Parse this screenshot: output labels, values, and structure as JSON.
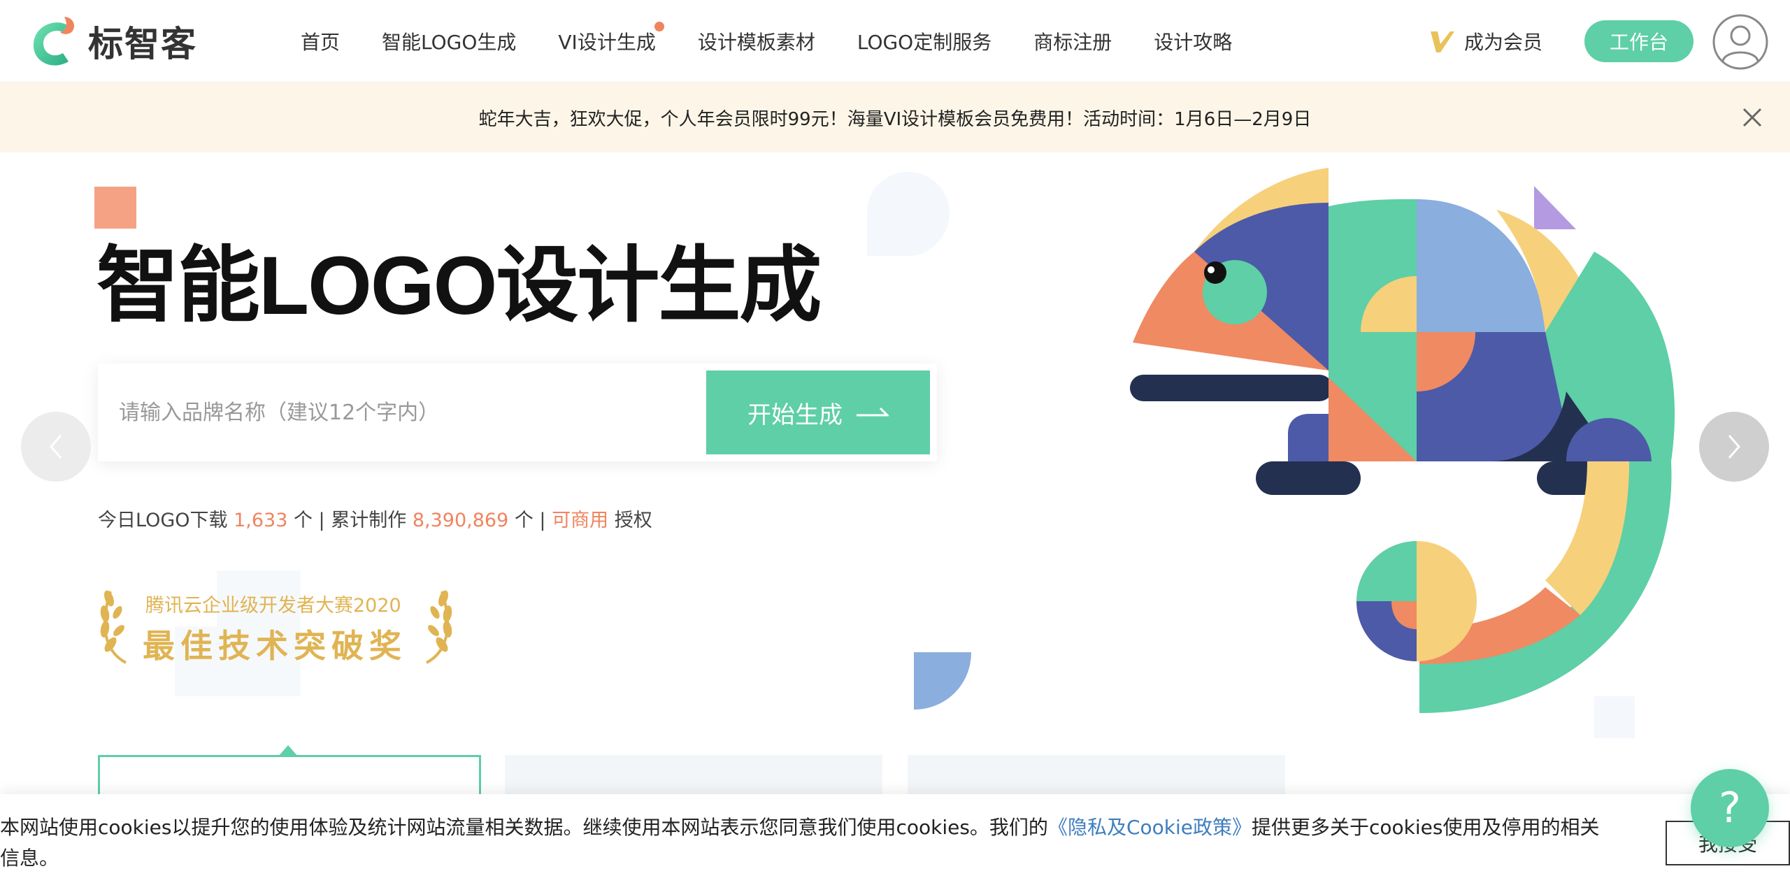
{
  "header": {
    "logo_text": "标智客",
    "nav": [
      {
        "label": "首页",
        "dot": false
      },
      {
        "label": "智能LOGO生成",
        "dot": false
      },
      {
        "label": "VI设计生成",
        "dot": true
      },
      {
        "label": "设计模板素材",
        "dot": false
      },
      {
        "label": "LOGO定制服务",
        "dot": false
      },
      {
        "label": "商标注册",
        "dot": false
      },
      {
        "label": "设计攻略",
        "dot": false
      }
    ],
    "vip_label": "成为会员",
    "workbench_label": "工作台"
  },
  "banner": {
    "text": "蛇年大吉，狂欢大促，个人年会员限时99元！海量VI设计模板会员免费用！活动时间：1月6日—2月9日"
  },
  "hero": {
    "title": "智能LOGO设计生成",
    "search_placeholder": "请输入品牌名称（建议12个字内）",
    "start_button": "开始生成",
    "stats": {
      "today_prefix": "今日LOGO下载 ",
      "today_count": "1,633",
      "today_suffix": " 个 | 累计制作 ",
      "total_count": "8,390,869",
      "total_suffix": " 个 | ",
      "commercial": "可商用",
      "license": " 授权"
    },
    "award": {
      "line1": "腾讯云企业级开发者大赛2020",
      "line2": "最佳技术突破奖"
    }
  },
  "cookie": {
    "text_before": "本网站使用cookies以提升您的使用体验及统计网站流量相关数据。继续使用本网站表示您同意我们使用cookies。我们的",
    "link": "《隐私及Cookie政策》",
    "text_after": "提供更多关于cookies使用及停用的相关信息。",
    "button": "我接受"
  },
  "help_label": "?",
  "colors": {
    "brand_green": "#5ecfa6",
    "accent_orange": "#f0845f",
    "gold": "#e0b453",
    "link_blue": "#3e7ebd"
  }
}
